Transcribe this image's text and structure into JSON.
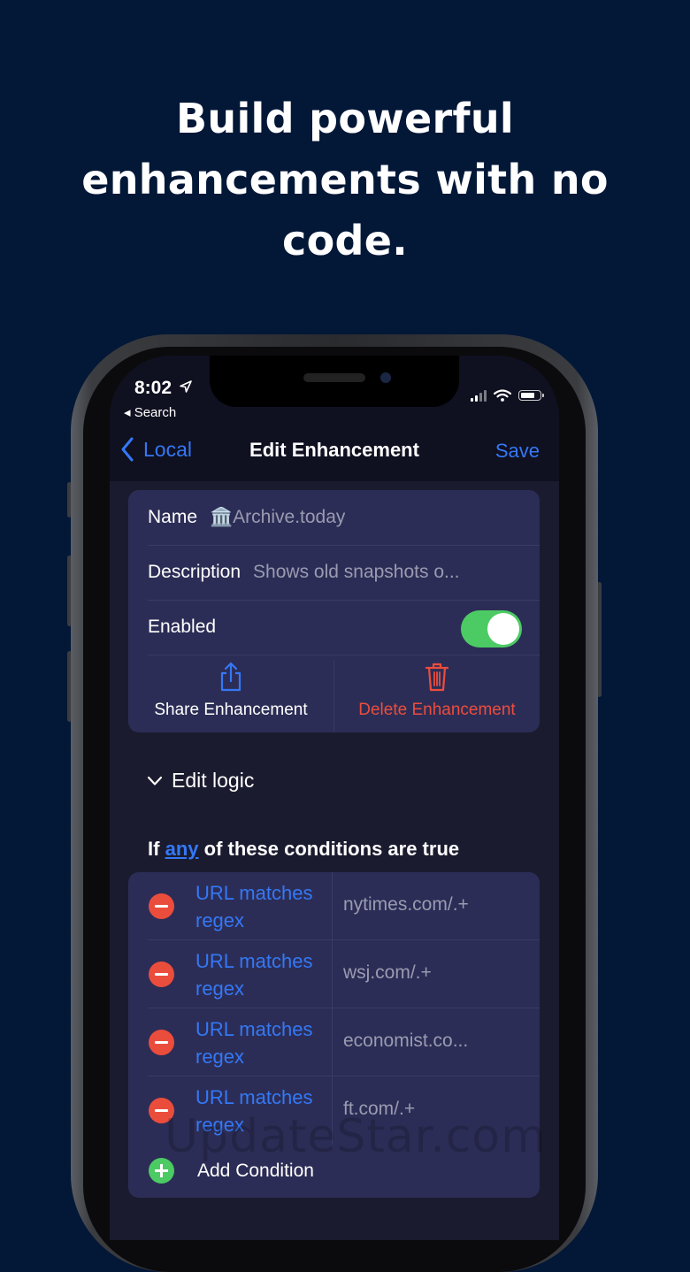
{
  "headline": {
    "line1": "Build powerful",
    "line2": "enhancements with no",
    "line3": "code."
  },
  "status_bar": {
    "time": "8:02",
    "back_label": "Search",
    "icons": [
      "location-arrow-icon",
      "cellular-signal-icon",
      "wifi-icon",
      "battery-icon"
    ]
  },
  "nav": {
    "back_label": "Local",
    "title": "Edit Enhancement",
    "save_label": "Save"
  },
  "form": {
    "name_label": "Name",
    "name_value": "🏛️Archive.today",
    "description_label": "Description",
    "description_value": "Shows old snapshots o...",
    "enabled_label": "Enabled",
    "enabled": true,
    "share_label": "Share Enhancement",
    "delete_label": "Delete Enhancement"
  },
  "logic": {
    "section_label": "Edit logic",
    "heading_prefix": "If",
    "heading_quantifier": "any",
    "heading_suffix": "of these conditions are true",
    "conditions": [
      {
        "type_line1": "URL matches",
        "type_line2": "regex",
        "value": "nytimes.com/.+"
      },
      {
        "type_line1": "URL matches",
        "type_line2": "regex",
        "value": "wsj.com/.+"
      },
      {
        "type_line1": "URL matches",
        "type_line2": "regex",
        "value": "economist.co..."
      },
      {
        "type_line1": "URL matches",
        "type_line2": "regex",
        "value": "ft.com/.+"
      }
    ],
    "add_label": "Add Condition"
  },
  "watermark": "UpdateStar.com",
  "colors": {
    "background": "#031737",
    "accent": "#3478f6",
    "destructive": "#eb4d3d",
    "success": "#4ccb64",
    "card": "#2c2d56"
  }
}
